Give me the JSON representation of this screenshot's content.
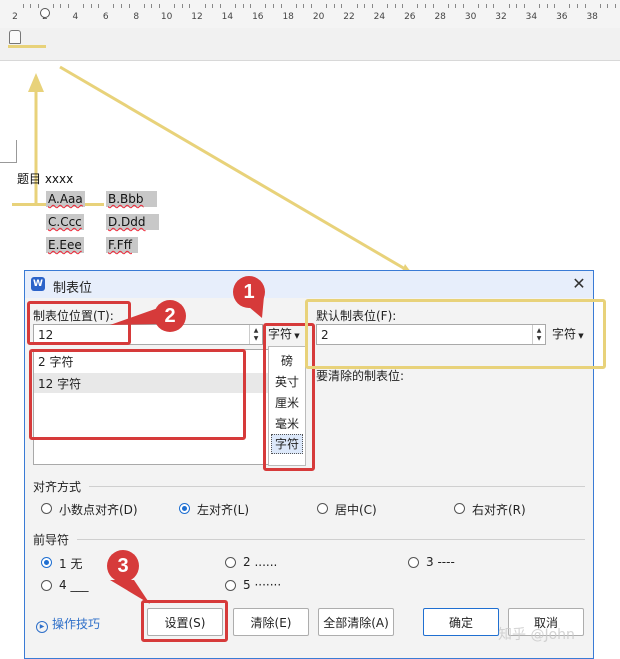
{
  "ruler": {
    "ticks": [
      "2",
      "2",
      "4",
      "6",
      "8",
      "10",
      "12",
      "14",
      "16",
      "18",
      "20",
      "22",
      "24",
      "26",
      "28",
      "30",
      "32",
      "34",
      "36",
      "38"
    ]
  },
  "document": {
    "question": "题目 xxxx",
    "options": [
      "A.Aaa",
      "B.Bbb",
      "C.Ccc",
      "D.Ddd",
      "E.Eee",
      "F.Fff"
    ]
  },
  "dialog": {
    "app_icon": "W",
    "title": "制表位",
    "close_icon": "close-icon",
    "tab_position_label": "制表位位置(T):",
    "tab_position_value": "12",
    "unit_dropdown": "字符",
    "tab_list": [
      "2 字符",
      "12 字符"
    ],
    "unit_menu": [
      "磅",
      "英寸",
      "厘米",
      "毫米",
      "字符"
    ],
    "default_tab_label": "默认制表位(F):",
    "default_tab_value": "2",
    "default_unit": "字符",
    "to_clear_label": "要清除的制表位:",
    "alignment": {
      "label": "对齐方式",
      "options": [
        "小数点对齐(D)",
        "左对齐(L)",
        "居中(C)",
        "右对齐(R)"
      ],
      "selected": "左对齐(L)"
    },
    "leader": {
      "label": "前导符",
      "options": [
        "1 无",
        "2 ......",
        "3 ----",
        "4 ___",
        "5 ·······"
      ],
      "selected": "1 无"
    },
    "tips_link": "操作技巧",
    "buttons": {
      "set": "设置(S)",
      "clear": "清除(E)",
      "clear_all": "全部清除(A)",
      "ok": "确定",
      "cancel": "取消"
    }
  },
  "annotations": {
    "badge1": "1",
    "badge2": "2",
    "badge3": "3"
  },
  "watermark": "知乎 @John",
  "colors": {
    "annotation_red": "#d63a3a",
    "annotation_yellow": "#e8d27a",
    "accent_blue": "#1f6fd1"
  }
}
